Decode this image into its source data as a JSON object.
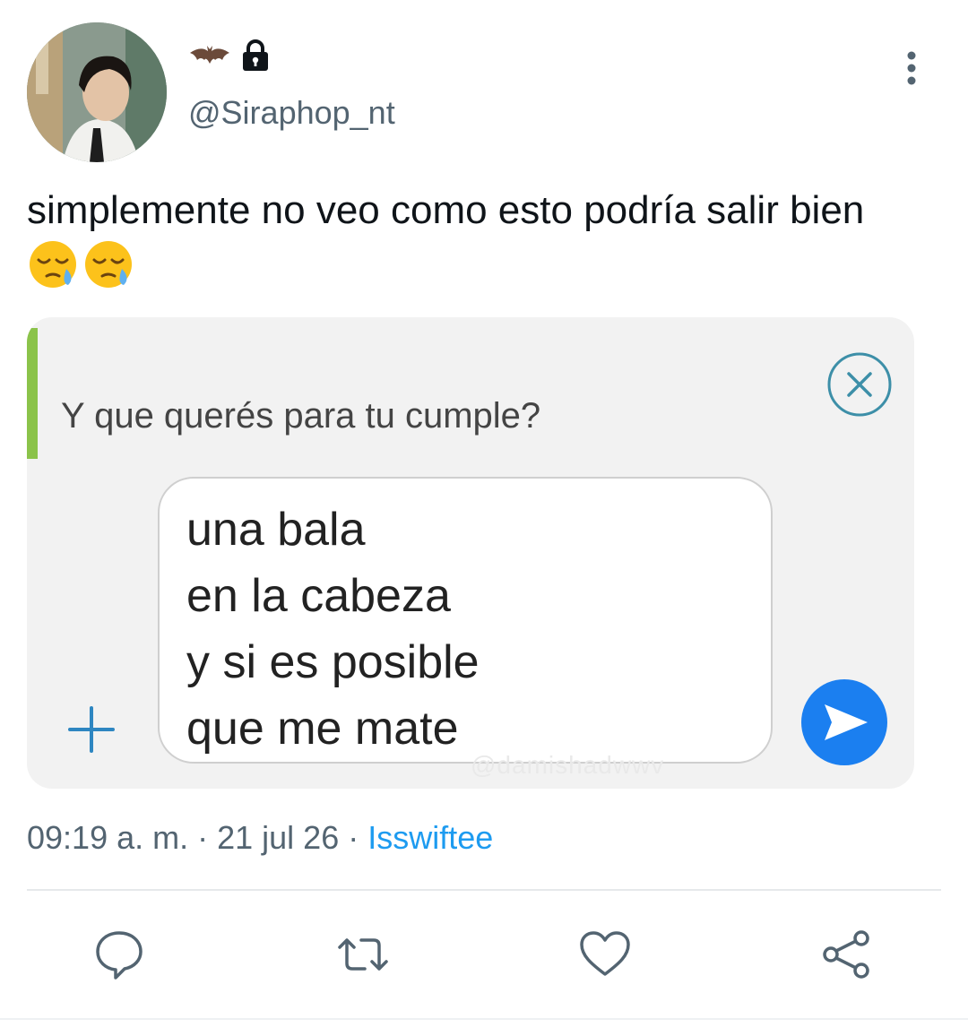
{
  "user": {
    "display_name_icons": [
      "bat-icon",
      "lock-icon"
    ],
    "handle": "@Siraphop_nt"
  },
  "tweet": {
    "text": "simplemente no veo como esto podría salir bien",
    "emojis": [
      "😪",
      "😪"
    ]
  },
  "media": {
    "reply_quote": "Y que querés para tu cumple?",
    "message_lines": [
      "una bala",
      "en la cabeza",
      "y si es posible",
      "que me mate"
    ],
    "watermark": "@damishadwwv"
  },
  "meta": {
    "time": "09:19 a. m.",
    "separator": " · ",
    "date": "21 jul 26",
    "source": "Isswiftee"
  },
  "actions": [
    "reply-icon",
    "retweet-icon",
    "like-icon",
    "share-icon"
  ],
  "colors": {
    "accent": "#1d9bf0",
    "muted": "#536471",
    "icon": "#536471",
    "send": "#1b7ff0"
  }
}
